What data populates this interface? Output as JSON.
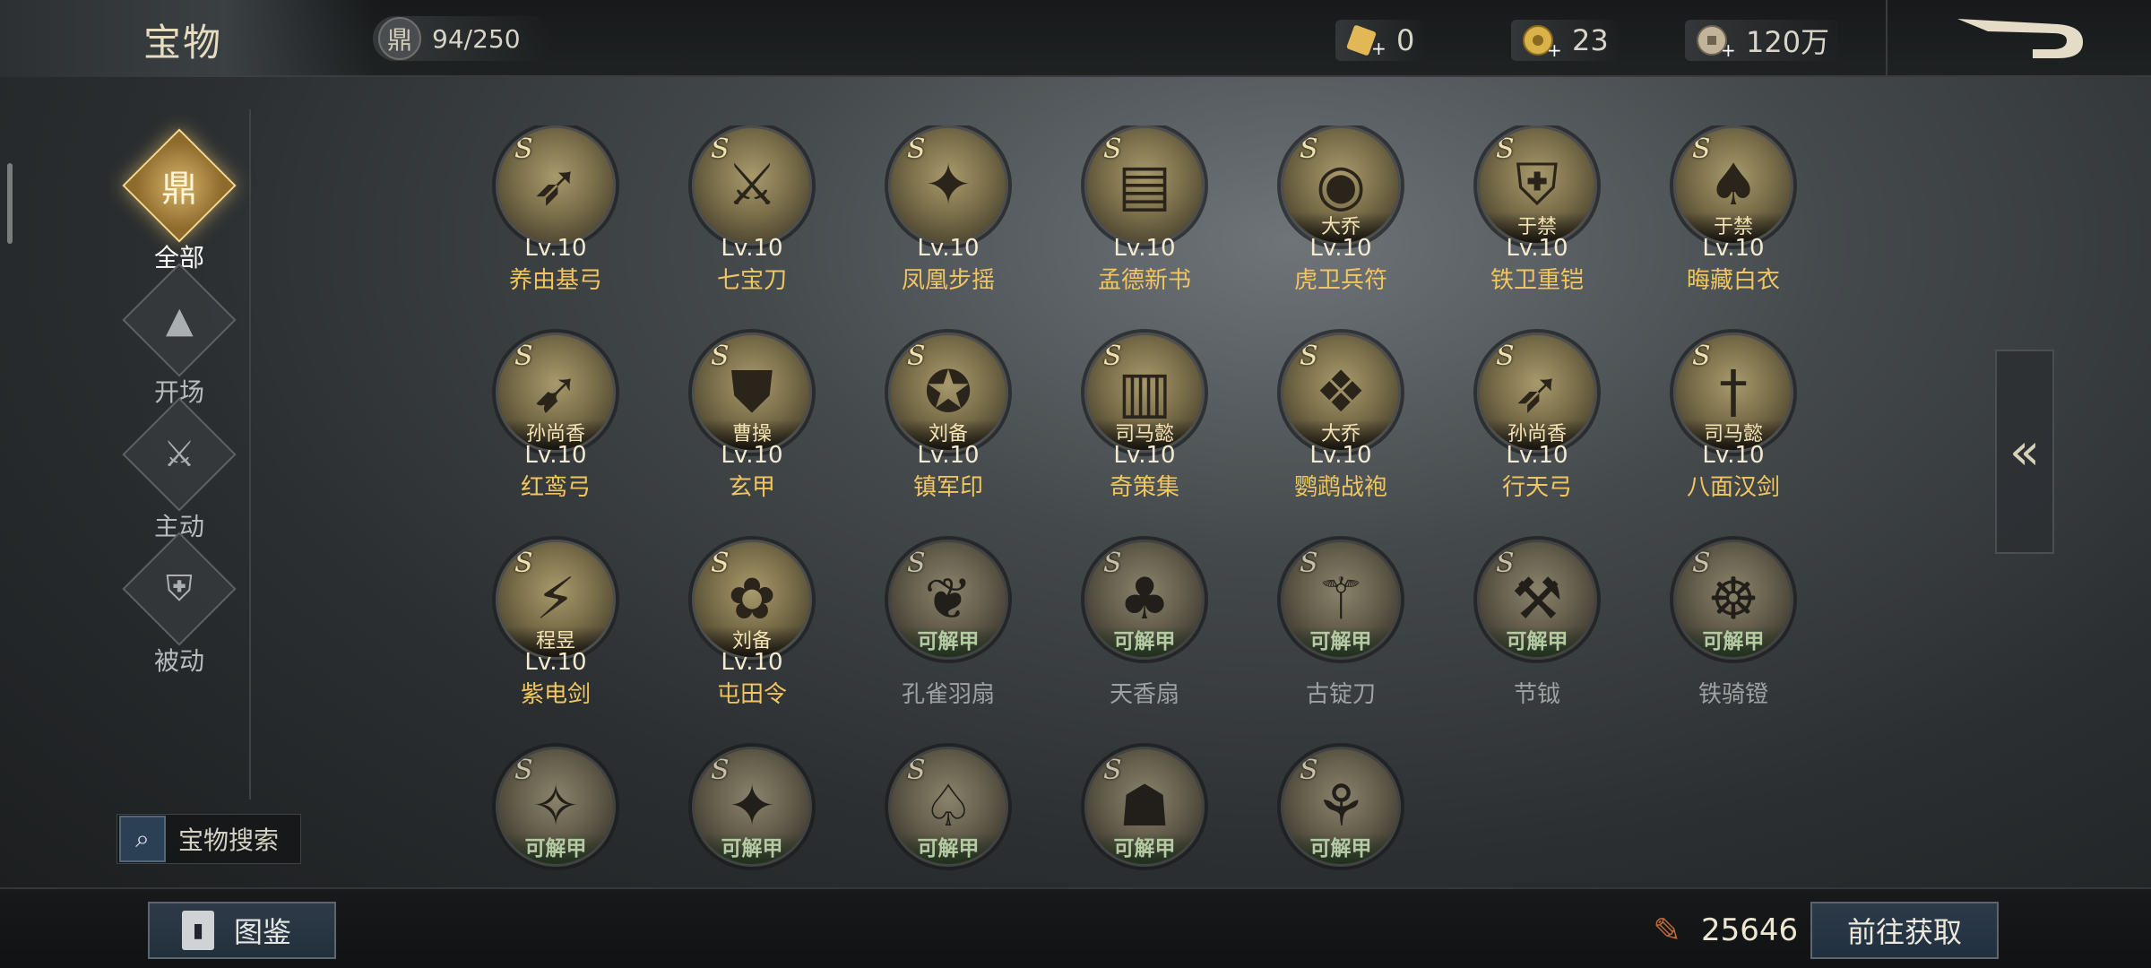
{
  "header": {
    "title": "宝物",
    "count": "94/250",
    "resources": [
      {
        "icon": "gold-ticket-icon",
        "value": "0"
      },
      {
        "icon": "gold-coin-icon",
        "value": "23"
      },
      {
        "icon": "copper-coin-icon",
        "value": "120万"
      }
    ]
  },
  "sidebar": {
    "items": [
      {
        "label": "全部",
        "icon": "all-treasure-icon",
        "active": true
      },
      {
        "label": "开场",
        "icon": "opening-icon",
        "active": false
      },
      {
        "label": "主动",
        "icon": "active-skill-icon",
        "active": false
      },
      {
        "label": "被动",
        "icon": "passive-skill-icon",
        "active": false
      }
    ],
    "search_label": "宝物搜索"
  },
  "grid": {
    "rows": [
      [
        {
          "tag": "",
          "level": "Lv.10",
          "name": "养由基弓",
          "owned": true
        },
        {
          "tag": "",
          "level": "Lv.10",
          "name": "七宝刀",
          "owned": true
        },
        {
          "tag": "",
          "level": "Lv.10",
          "name": "凤凰步摇",
          "owned": true
        },
        {
          "tag": "",
          "level": "Lv.10",
          "name": "孟德新书",
          "owned": true
        },
        {
          "tag": "大乔",
          "level": "Lv.10",
          "name": "虎卫兵符",
          "owned": true
        },
        {
          "tag": "于禁",
          "level": "Lv.10",
          "name": "铁卫重铠",
          "owned": true
        },
        {
          "tag": "于禁",
          "level": "Lv.10",
          "name": "晦藏白衣",
          "owned": true
        }
      ],
      [
        {
          "tag": "孙尚香",
          "level": "Lv.10",
          "name": "红鸾弓",
          "owned": true
        },
        {
          "tag": "曹操",
          "level": "Lv.10",
          "name": "玄甲",
          "owned": true
        },
        {
          "tag": "刘备",
          "level": "Lv.10",
          "name": "镇军印",
          "owned": true
        },
        {
          "tag": "司马懿",
          "level": "Lv.10",
          "name": "奇策集",
          "owned": true
        },
        {
          "tag": "大乔",
          "level": "Lv.10",
          "name": "鹦鹉战袍",
          "owned": true
        },
        {
          "tag": "孙尚香",
          "level": "Lv.10",
          "name": "行天弓",
          "owned": true
        },
        {
          "tag": "司马懿",
          "level": "Lv.10",
          "name": "八面汉剑",
          "owned": true
        }
      ],
      [
        {
          "tag": "程昱",
          "level": "Lv.10",
          "name": "紫电剑",
          "owned": true
        },
        {
          "tag": "刘备",
          "level": "Lv.10",
          "name": "屯田令",
          "owned": true
        },
        {
          "tag": "可解甲",
          "level": "",
          "name": "孔雀羽扇",
          "owned": false
        },
        {
          "tag": "可解甲",
          "level": "",
          "name": "天香扇",
          "owned": false
        },
        {
          "tag": "可解甲",
          "level": "",
          "name": "古锭刀",
          "owned": false
        },
        {
          "tag": "可解甲",
          "level": "",
          "name": "节钺",
          "owned": false
        },
        {
          "tag": "可解甲",
          "level": "",
          "name": "铁骑镫",
          "owned": false
        }
      ],
      [
        {
          "tag": "可解甲",
          "level": "",
          "name": "",
          "owned": false
        },
        {
          "tag": "可解甲",
          "level": "",
          "name": "",
          "owned": false
        },
        {
          "tag": "可解甲",
          "level": "",
          "name": "",
          "owned": false
        },
        {
          "tag": "可解甲",
          "level": "",
          "name": "",
          "owned": false
        },
        {
          "tag": "可解甲",
          "level": "",
          "name": "",
          "owned": false
        }
      ]
    ],
    "s_mark": "S"
  },
  "footer": {
    "codex_label": "图鉴",
    "currency_value": "25646",
    "currency_icon": "quill-token-icon",
    "goto_label": "前往获取"
  },
  "colors": {
    "owned_name": "#f1c660",
    "locked_name": "#9ea1a1",
    "unlock_tag": "#c8f5a8",
    "accent_gold": "#d6b56a"
  }
}
